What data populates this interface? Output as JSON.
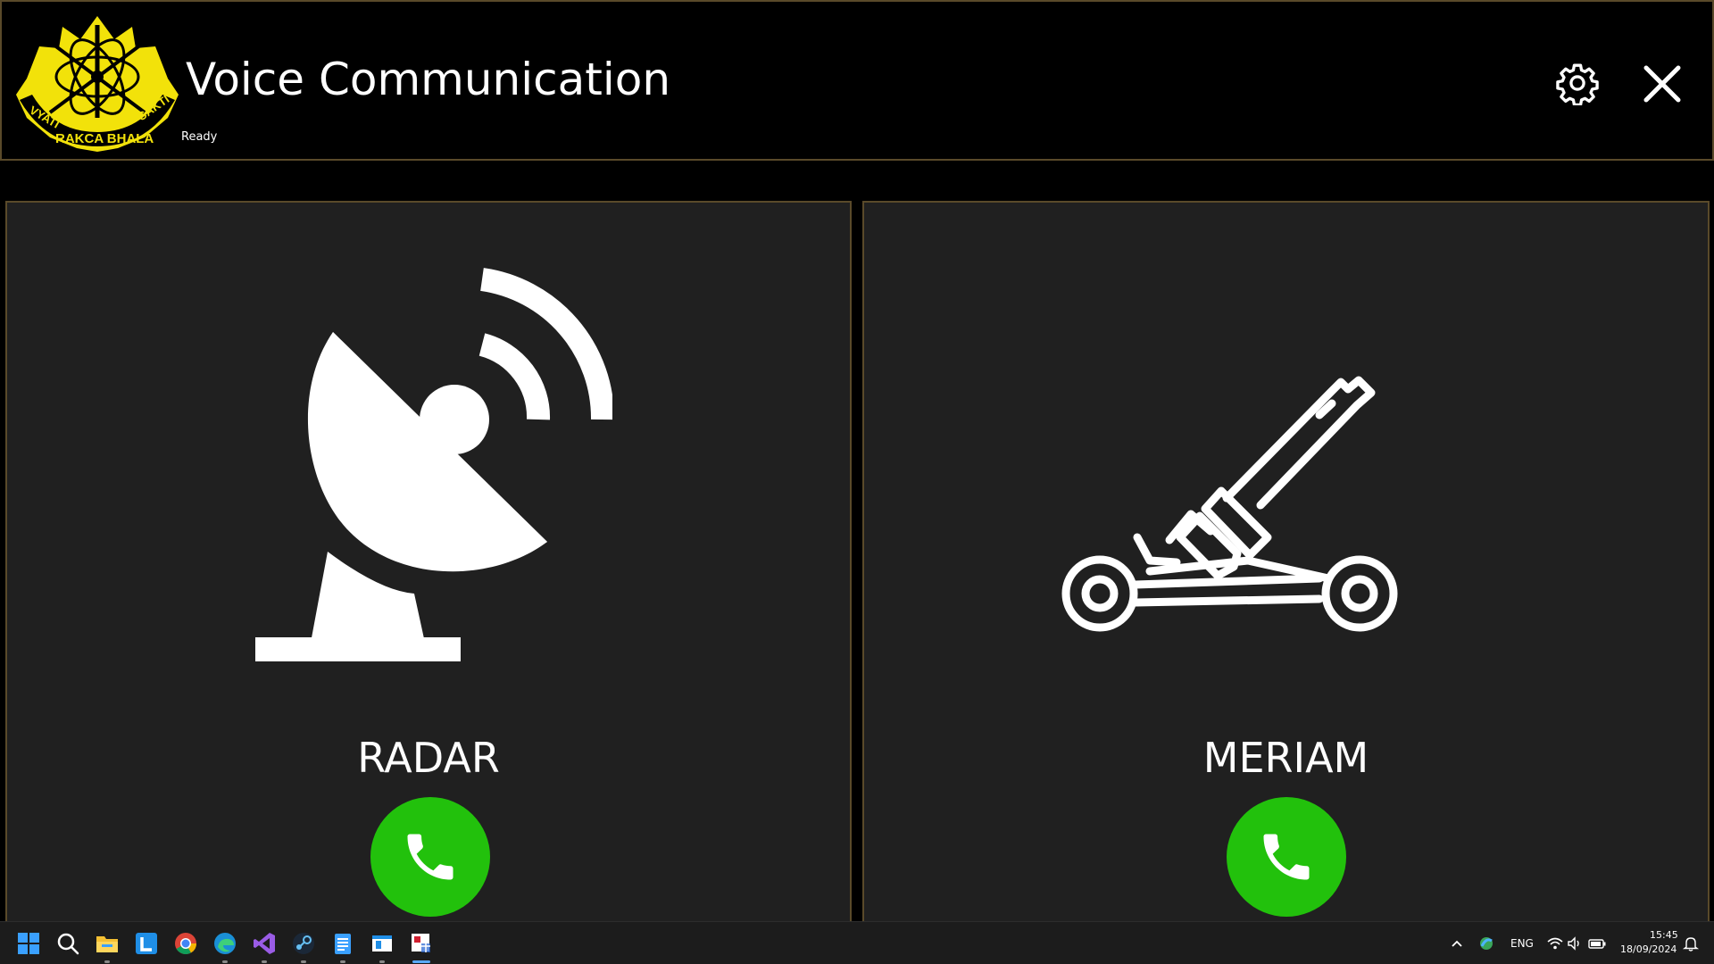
{
  "app": {
    "title": "Voice Communication",
    "status": "Ready",
    "logo": {
      "icon": "army-crest-icon",
      "motto_left": "VYATI",
      "motto_bottom": "RAKCA BHALA",
      "motto_right": "CAKTI"
    }
  },
  "header": {
    "settings_icon": "gear-icon",
    "close_icon": "close-icon"
  },
  "panels": [
    {
      "label": "RADAR",
      "icon": "satellite-dish-icon",
      "action_icon": "phone-icon"
    },
    {
      "label": "MERIAM",
      "icon": "artillery-cannon-icon",
      "action_icon": "phone-icon"
    }
  ],
  "taskbar": {
    "apps": [
      "windows-start-icon",
      "search-icon",
      "file-explorer-icon",
      "l-app-icon",
      "chrome-icon",
      "edge-icon",
      "visual-studio-icon",
      "steam-icon",
      "notepad-icon",
      "window-app-icon",
      "voice-app-icon"
    ],
    "tray": {
      "language": "ENG",
      "time": "15:45",
      "date": "18/09/2024"
    }
  },
  "colors": {
    "panel_bg": "#202020",
    "border": "#5a4a2a",
    "call_green": "#22c10c",
    "logo_yellow": "#f2e20a"
  }
}
